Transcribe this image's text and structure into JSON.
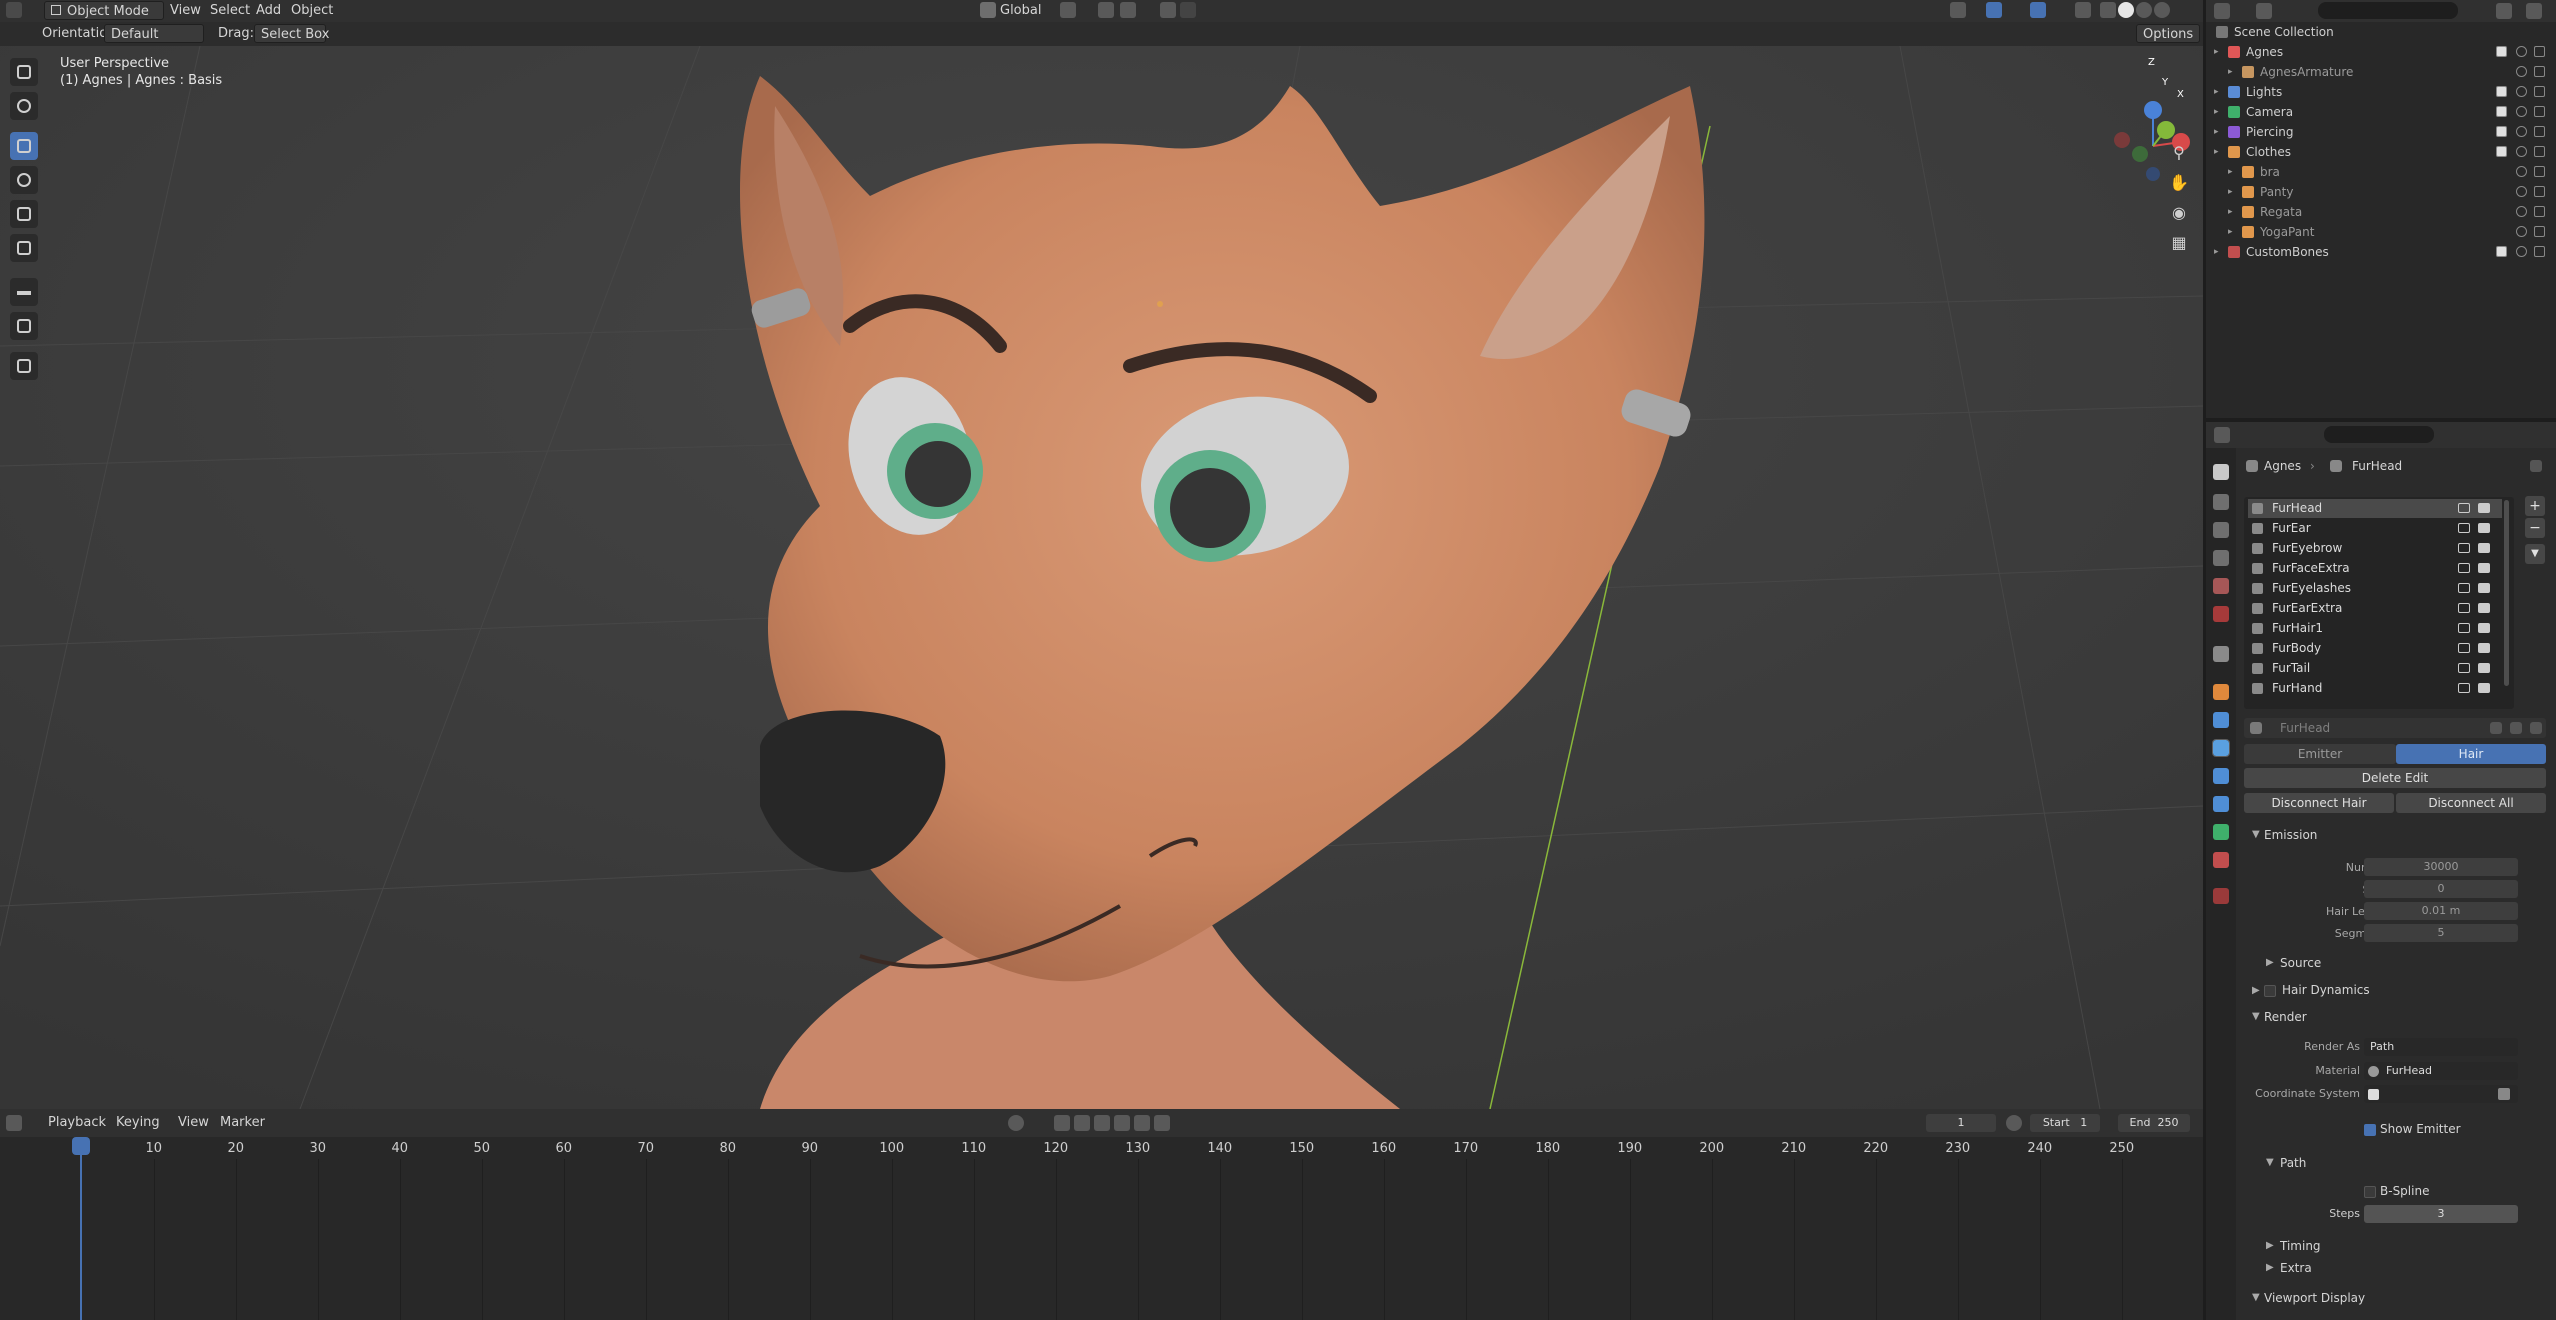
{
  "header": {
    "mode": "Object Mode",
    "menus": [
      "View",
      "Select",
      "Add",
      "Object"
    ],
    "transform_orientation": "Global",
    "orientation_label": "Orientation:",
    "orientation_value": "Default",
    "drag_label": "Drag:",
    "drag_value": "Select Box",
    "options_label": "Options"
  },
  "viewport": {
    "view_name": "User Perspective",
    "object_info": "(1) Agnes | Agnes : Basis",
    "gizmo": {
      "x": "X",
      "y": "Y",
      "z": "Z"
    }
  },
  "timeline": {
    "menus": [
      "Playback",
      "Keying",
      "View",
      "Marker"
    ],
    "current_frame": "1",
    "start_label": "Start",
    "start_value": "1",
    "end_label": "End",
    "end_value": "250",
    "frame_markers": [
      "1",
      "10",
      "20",
      "30",
      "40",
      "50",
      "60",
      "70",
      "80",
      "90",
      "100",
      "110",
      "120",
      "130",
      "140",
      "150",
      "160",
      "170",
      "180",
      "190",
      "200",
      "210",
      "220",
      "230",
      "240",
      "250"
    ]
  },
  "outliner": {
    "root": "Scene Collection",
    "rows": [
      {
        "label": "Agnes",
        "depth": 1,
        "color": "#e05757"
      },
      {
        "label": "AgnesArmature",
        "depth": 2,
        "color": "#c69660"
      },
      {
        "label": "Lights",
        "depth": 1,
        "color": "#5a8cd6"
      },
      {
        "label": "Camera",
        "depth": 1,
        "color": "#3fb06b"
      },
      {
        "label": "Piercing",
        "depth": 1,
        "color": "#8c5ad6"
      },
      {
        "label": "Clothes",
        "depth": 1,
        "color": "#e0974c"
      },
      {
        "label": "bra",
        "depth": 2,
        "color": "#e0974c"
      },
      {
        "label": "Panty",
        "depth": 2,
        "color": "#e0974c"
      },
      {
        "label": "Regata",
        "depth": 2,
        "color": "#e0974c"
      },
      {
        "label": "YogaPant",
        "depth": 2,
        "color": "#e0974c"
      },
      {
        "label": "CustomBones",
        "depth": 1,
        "color": "#c24e4e"
      }
    ]
  },
  "properties": {
    "breadcrumb_object": "Agnes",
    "breadcrumb_system": "FurHead",
    "particle_systems": [
      "FurHead",
      "FurEar",
      "FurEyebrow",
      "FurFaceExtra",
      "FurEyelashes",
      "FurEarExtra",
      "FurHair1",
      "FurBody",
      "FurTail",
      "FurHand"
    ],
    "selected_system": "FurHead",
    "settings_name": "FurHead",
    "type_tabs": [
      "Emitter",
      "Hair"
    ],
    "active_type": "Hair",
    "delete_edit": "Delete Edit",
    "disconnect_hair": "Disconnect Hair",
    "disconnect_all": "Disconnect All",
    "emission": {
      "title": "Emission",
      "number_label": "Number",
      "number": "30000",
      "seed_label": "Seed",
      "seed": "0",
      "hair_length_label": "Hair Length",
      "hair_length": "0.01 m",
      "segments_label": "Segments",
      "segments": "5"
    },
    "source": "Source",
    "hair_dynamics": "Hair Dynamics",
    "render": {
      "title": "Render",
      "render_as_label": "Render As",
      "render_as": "Path",
      "material_label": "Material",
      "material": "FurHead",
      "coord_system_label": "Coordinate System",
      "show_emitter": "Show Emitter"
    },
    "path": {
      "title": "Path",
      "bspline": "B-Spline",
      "steps_label": "Steps",
      "steps": "3"
    },
    "timing": "Timing",
    "extra": "Extra",
    "viewport_display": "Viewport Display"
  }
}
